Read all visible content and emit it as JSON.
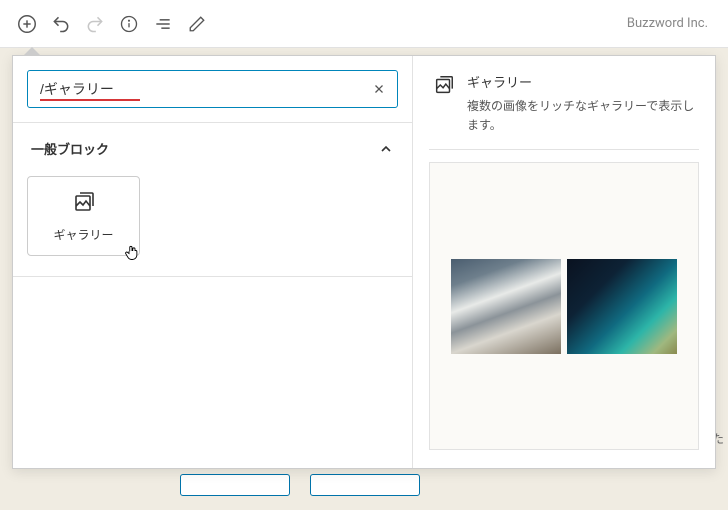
{
  "brand": "Buzzword Inc.",
  "search": {
    "value": "/ギャラリー"
  },
  "category": {
    "label": "一般ブロック"
  },
  "blocks": [
    {
      "label": "ギャラリー"
    }
  ],
  "preview": {
    "title": "ギャラリー",
    "description": "複数の画像をリッチなギャラリーで表示します。"
  },
  "bg_partial_text": "くた"
}
